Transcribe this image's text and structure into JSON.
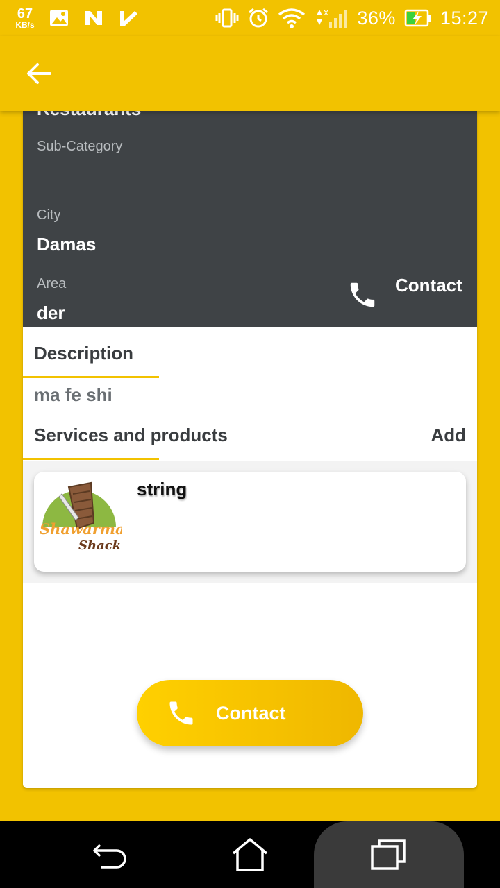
{
  "status_bar": {
    "speed_value": "67",
    "speed_unit": "KB/s",
    "battery_percent": "36%",
    "time": "15:27"
  },
  "details": {
    "category_value": "Restaurants",
    "subcategory_label": "Sub-Category",
    "subcategory_value": "",
    "city_label": "City",
    "city_value": "Damas",
    "area_label": "Area",
    "area_value": "der",
    "contact_label": "Contact"
  },
  "description": {
    "title": "Description",
    "text": "ma fe shi"
  },
  "services": {
    "title": "Services and products",
    "add_label": "Add",
    "items": [
      {
        "name": "string",
        "logo_text_1": "Shawarma",
        "logo_text_2": "Shack"
      }
    ]
  },
  "contact_button": {
    "label": "Contact"
  },
  "colors": {
    "accent": "#f2c200",
    "dark_panel": "#3f4346"
  }
}
